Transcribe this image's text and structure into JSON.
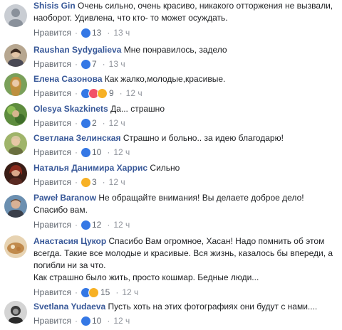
{
  "actions": {
    "like_label": "Нравится",
    "separator": "·"
  },
  "colors": {
    "author": "#385898",
    "meta": "#606770",
    "like_reaction": "#3578e5",
    "love_reaction": "#f25268",
    "wow_reaction": "#f7b125"
  },
  "comments": [
    {
      "author": "Shisis Gin",
      "text_lines": [
        "Очень сильно, очень красиво, никакого отторжения не вызвали,",
        "наоборот. Удивлена, что кто- то может осуждать."
      ],
      "reactions": [
        "like-icon"
      ],
      "count": "13",
      "time": "13 ч"
    },
    {
      "author": "Raushan Sydygalieva",
      "text_lines": [
        "Мне понравилось, задело"
      ],
      "reactions": [
        "like-icon"
      ],
      "count": "7",
      "time": "13 ч"
    },
    {
      "author": "Елена Сазонова",
      "text_lines": [
        "Как жалко,молодые,красивые."
      ],
      "reactions": [
        "like-icon",
        "love-icon",
        "sad-icon"
      ],
      "count": "9",
      "time": "12 ч"
    },
    {
      "author": "Olesya Skazkinets",
      "text_lines": [
        "Да... страшно"
      ],
      "reactions": [
        "like-icon"
      ],
      "count": "2",
      "time": "12 ч"
    },
    {
      "author": "Светлана Зелинская",
      "text_lines": [
        "Страшно и больно.. за идею благодарю!"
      ],
      "reactions": [
        "like-icon"
      ],
      "count": "10",
      "time": "12 ч"
    },
    {
      "author": "Наталья Данимира Харрис",
      "text_lines": [
        "Сильно"
      ],
      "reactions": [
        "sad-icon"
      ],
      "count": "3",
      "time": "12 ч"
    },
    {
      "author": "Paweł Baranow",
      "text_lines": [
        "Не обращайте внимания! Вы делаете доброе дело!",
        "Спасибо вам."
      ],
      "reactions": [
        "like-icon"
      ],
      "count": "12",
      "time": "12 ч"
    },
    {
      "author": "Анастасия Цукор",
      "text_lines": [
        "Спасибо Вам огромное, Хасан! Надо помнить об этом",
        "всегда. Такие все молодые и красивые. Вся жизнь, казалось бы впереди, а",
        "погибли ни за что.",
        "Как страшно было жить, просто кошмар. Бедные люди..."
      ],
      "reactions": [
        "like-icon",
        "sad-icon"
      ],
      "count": "15",
      "time": "12 ч"
    },
    {
      "author": "Svetlana Yudaeva",
      "text_lines": [
        "Пусть хоть на этих фотографиях они будут с нами...."
      ],
      "reactions": [
        "like-icon"
      ],
      "count": "10",
      "time": "12 ч"
    }
  ]
}
